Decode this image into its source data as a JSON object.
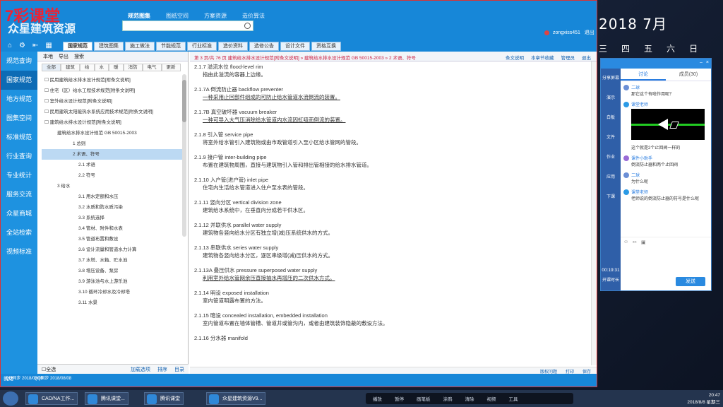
{
  "app": {
    "logo_text": "众星建筑资源",
    "overlay_text": "7彩课堂",
    "nav": [
      "规范图集",
      "图纸空间",
      "方案资源",
      "造价算法"
    ],
    "search_placeholder": "",
    "user": "zongxiss451",
    "logout": "退出",
    "doc_tabs": [
      "国家规范",
      "建筑图集",
      "施工做法",
      "节能规范",
      "行业标准",
      "造价资料",
      "选修公告",
      "设计文件",
      "资格互换"
    ]
  },
  "sidebar": [
    "规范查询",
    "国家规范",
    "地方规范",
    "图集空间",
    "标准规范",
    "行业查询",
    "专业统计",
    "服务交流",
    "众星商城",
    "全站检索",
    "视频标准"
  ],
  "tree": {
    "top_labels": [
      "本地",
      "导出",
      "搜索"
    ],
    "tabs": [
      "全部",
      "建筑",
      "给",
      "水",
      "暖",
      "消防",
      "电气",
      "更新"
    ],
    "items": [
      {
        "text": "☐ 民用建筑给水排水设计规范[附条文说明]",
        "level": 0
      },
      {
        "text": "☐ 住宅（区）给水工程技术规范[附条文说明]",
        "level": 0
      },
      {
        "text": "☐ 室外给水设计规范[附条文说明]",
        "level": 0
      },
      {
        "text": "☐ 民用建筑太阳能热水系统应用技术规范[附条文说明]",
        "level": 0
      },
      {
        "text": "☐ 建筑给水排水设计规范[附条文说明]",
        "level": 0
      },
      {
        "text": "建筑给水排水设计规范 GB 50015-2003",
        "level": 1
      },
      {
        "text": "1 总则",
        "level": 2
      },
      {
        "text": "2 术语、符号",
        "level": 2,
        "selected": true
      },
      {
        "text": "2.1 术语",
        "level": 3
      },
      {
        "text": "2.2 符号",
        "level": 3
      },
      {
        "text": "3 给水",
        "level": 1
      },
      {
        "text": "3.1 用水定额和水压",
        "level": 3
      },
      {
        "text": "3.2 水质和防水质污染",
        "level": 3
      },
      {
        "text": "3.3 系统选择",
        "level": 3
      },
      {
        "text": "3.4 管材、附件和水表",
        "level": 3
      },
      {
        "text": "3.5 管道布置和敷设",
        "level": 3
      },
      {
        "text": "3.6 设计流量和管道水力计算",
        "level": 3
      },
      {
        "text": "3.7 水塔、水箱、贮水池",
        "level": 3
      },
      {
        "text": "3.8 增压设备、泵房",
        "level": 3
      },
      {
        "text": "3.9 游泳池与水上游乐池",
        "level": 3
      },
      {
        "text": "3.10 循环冷却水及冷却塔",
        "level": 3
      },
      {
        "text": "3.11 水景",
        "level": 3
      }
    ],
    "bottom_left": "☐全选",
    "bottom_right": [
      "加载选项",
      "排序",
      "目录"
    ]
  },
  "content": {
    "header": "第 3 页/共 76 页    建筑给水排水设计规范[附条文说明] » 建筑给水排水设计规范 GB 50015-2003 » 2 术语、符号",
    "header_right": [
      "条文说明",
      "本章节收藏",
      "管理员",
      "退出"
    ],
    "entries": [
      {
        "title": "2.1.7 溢流水位  flood-level rim",
        "desc": "指由此溢流的容器上边缘。",
        "desc_underline": false
      },
      {
        "title": "2.1.7A 倒流防止器  backflow preventer",
        "desc": "一种采用止回部件组成的可防止给水管道水流倒流的装置。",
        "desc_underline": true
      },
      {
        "title": "2.1.7B 真空破坏器  vacuum breaker",
        "desc": "一种可导入大气压消除给水管道内水流因虹吸而倒流的装置。",
        "desc_underline": true
      },
      {
        "title": "2.1.8 引入管  service pipe",
        "desc": "将室外给水管引入建筑物或由市政管道引入至小区给水管网的管段。",
        "desc_underline": false
      },
      {
        "title": "2.1.9 接户管  inter-building pipe",
        "desc": "布置在建筑物周围，直接与建筑物引入管和排出管相接的给水排水管道。",
        "desc_underline": false
      },
      {
        "title": "2.1.10 入户管(进户管)  inlet pipe",
        "desc": "住宅内生活给水管道进入住户至水表的管段。",
        "desc_underline": false
      },
      {
        "title": "2.1.11 竖向分区  vertical division zone",
        "desc": "建筑给水系统中，在垂直向分成若干供水区。",
        "desc_underline": false
      },
      {
        "title": "2.1.12 并联供水  parallel water supply",
        "desc": "建筑物各竖向给水分区有独立增(减)压系统供水的方式。",
        "desc_underline": false
      },
      {
        "title": "2.1.13 串联供水  series water supply",
        "desc": "建筑物各竖向给水分区，逐区串级增(减)压供水的方式。",
        "desc_underline": false
      },
      {
        "title": "2.1.13A 叠压供水  pressure superposed water supply",
        "desc": "利用室外给水管网余压直接抽水再增压的二次供水方式。",
        "desc_underline": true
      },
      {
        "title": "2.1.14 明设  exposed installation",
        "desc": "室内管道明露布置的方法。",
        "desc_underline": false
      },
      {
        "title": "2.1.15 暗设  concealed installation, embedded installation",
        "desc": "室内管道布置在墙体管槽、管道井或管沟内，或者由建筑装饰隐蔽的敷设方法。",
        "desc_underline": false
      },
      {
        "title": "2.1.16 分水器  manifold",
        "desc": "",
        "desc_underline": false
      }
    ],
    "footer_right": [
      "版权问题",
      "打印",
      "保存"
    ]
  },
  "statusbar": "就绪",
  "desktop": {
    "date": "2018 7月",
    "weekdays": [
      "三",
      "四",
      "五",
      "六",
      "日"
    ]
  },
  "chat": {
    "title": "",
    "tabs": [
      "讨论",
      "成员(30)"
    ],
    "side_icons": [
      "分享屏幕",
      "演示",
      "白板",
      "文件",
      "作业",
      "应用",
      "下课"
    ],
    "time": "00:19:31",
    "time_label": "开课时长",
    "messages": [
      {
        "who": "二球",
        "text": "那它这个有啥作用呢？",
        "dot": "a"
      },
      {
        "who": "课堂老师",
        "text": "",
        "dot": "b",
        "image": true
      },
      {
        "who": "",
        "text": "这个就是2个止回阀一样的",
        "dot": ""
      },
      {
        "who": "课件小助手",
        "text": "倒流防止器和两个止回阀",
        "dot": "c"
      },
      {
        "who": "二球",
        "text": "为什么呢",
        "dot": "a"
      },
      {
        "who": "课堂老师",
        "text": "老师说的倒流防止器的符号是什么呢",
        "dot": "b"
      }
    ],
    "send_label": "发送"
  },
  "taskbar": {
    "apps": [
      "CAD/NA工作...",
      "腾讯课堂...",
      "腾讯课堂",
      "众星建筑资源V9..."
    ],
    "player": [
      "播放",
      "暂停",
      "画笔板",
      "涂鸦",
      "清除",
      "视频",
      "工具"
    ],
    "qq": [
      "QQ同步 2018/08/08",
      "QQ同步 2018/08/08"
    ],
    "tray_time": "20:47",
    "tray_date": "2018/8/8 星期三"
  }
}
